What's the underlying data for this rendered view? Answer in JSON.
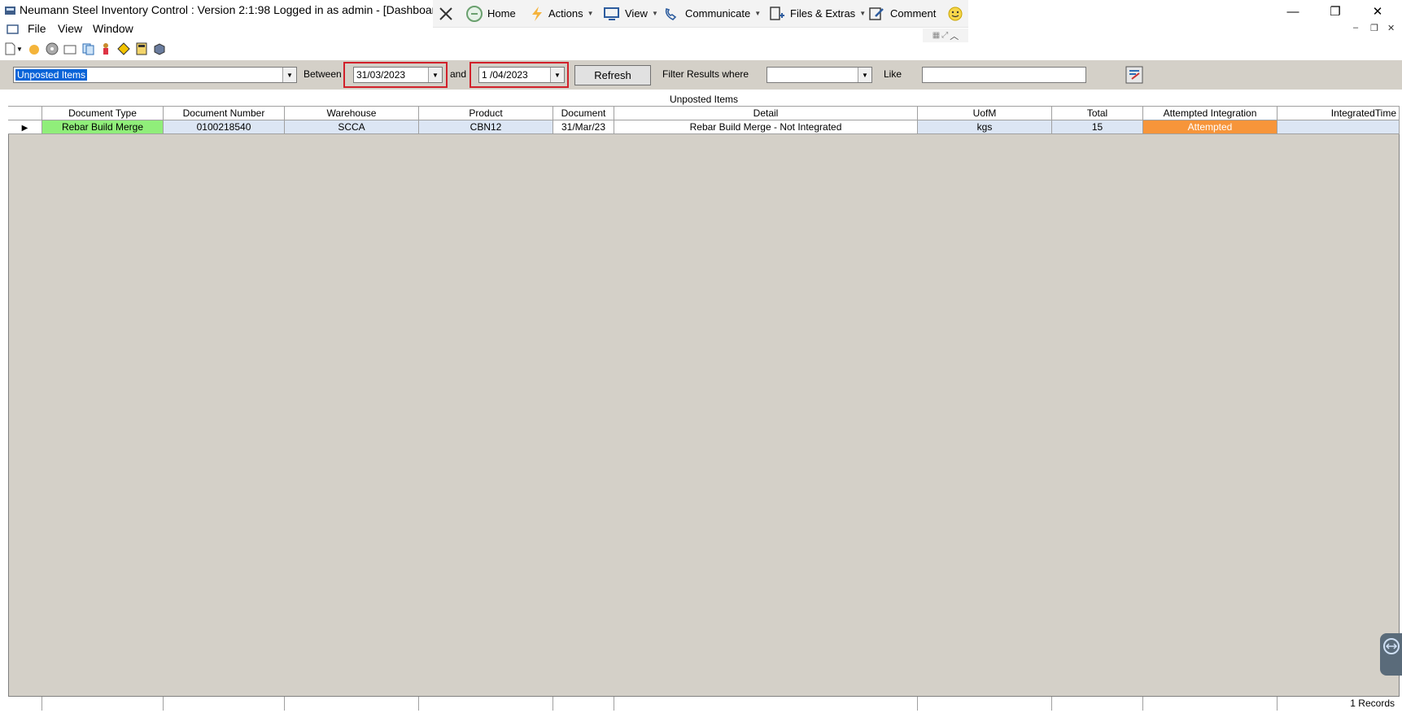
{
  "window": {
    "title": "Neumann Steel Inventory Control : Version 2:1:98 Logged in as admin - [Dashboard]"
  },
  "ribbon": {
    "home": "Home",
    "actions": "Actions",
    "view": "View",
    "communicate": "Communicate",
    "files": "Files & Extras",
    "comment": "Comment"
  },
  "menu": {
    "file": "File",
    "view": "View",
    "window": "Window"
  },
  "filter": {
    "report": "Unposted Items",
    "between_label": "Between",
    "date_from": "31/03/2023",
    "and_label": "and",
    "date_to": "1 /04/2023",
    "refresh": "Refresh",
    "filter_label": "Filter Results where",
    "filter_field": "",
    "like_label": "Like",
    "like_value": ""
  },
  "grid": {
    "caption": "Unposted Items",
    "columns": [
      "Document Type",
      "Document Number",
      "Warehouse",
      "Product",
      "Document",
      "Detail",
      "UofM",
      "Total",
      "Attempted Integration",
      "IntegratedTime"
    ],
    "rows": [
      [
        "Rebar Build Merge",
        "0100218540",
        "SCCA",
        "CBN12",
        "31/Mar/23",
        "Rebar Build Merge - Not Integrated",
        "kgs",
        "15",
        "Attempted",
        ""
      ]
    ],
    "records": "1 Records"
  },
  "colors": {
    "doc_type_bg": "#90ee7a",
    "attempted_bg": "#f7953a",
    "row_bg": "#dce6f4",
    "grid_bg": "#d4d0c8",
    "highlight": "#d1202a"
  }
}
